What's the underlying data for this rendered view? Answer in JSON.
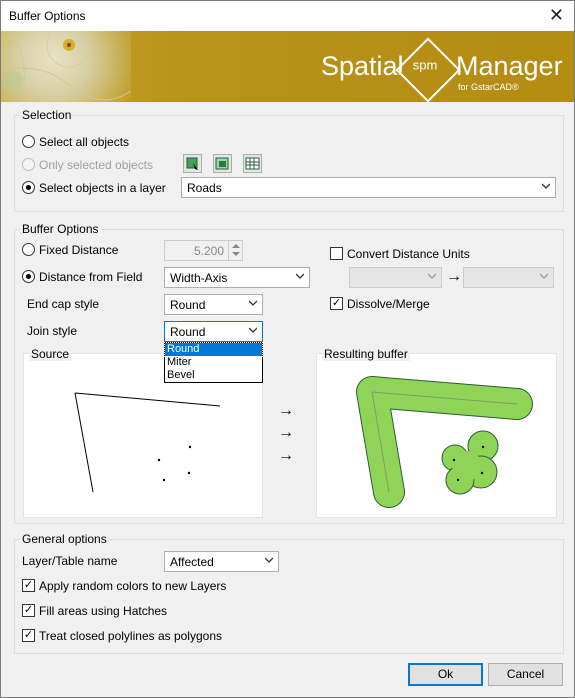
{
  "window": {
    "title": "Buffer Options"
  },
  "banner": {
    "brand_left": "Spatial",
    "brand_logo": "spm",
    "brand_right": "Manager",
    "brand_sub": "for GstarCAD®"
  },
  "selection": {
    "group_label": "Selection",
    "all_objects": "Select all objects",
    "only_selected": "Only selected objects",
    "in_layer": "Select objects in a layer",
    "layer_value": "Roads"
  },
  "buffer": {
    "group_label": "Buffer Options",
    "fixed_distance": "Fixed Distance",
    "fixed_value": "5.200",
    "distance_field": "Distance from Field",
    "field_value": "Width-Axis",
    "end_cap_label": "End cap style",
    "end_cap_value": "Round",
    "join_label": "Join style",
    "join_value": "Round",
    "join_options": [
      "Round",
      "Miter",
      "Bevel"
    ],
    "convert_units": "Convert Distance Units",
    "dissolve": "Dissolve/Merge",
    "source_label": "Source",
    "result_label": "Resulting buffer"
  },
  "general": {
    "group_label": "General options",
    "layer_name_label": "Layer/Table name",
    "layer_name_value": "Affected",
    "random_colors": "Apply random colors to new Layers",
    "fill_hatches": "Fill areas using Hatches",
    "closed_polylines": "Treat closed polylines as polygons"
  },
  "buttons": {
    "ok": "Ok",
    "cancel": "Cancel"
  },
  "colors": {
    "accent": "#0078d7",
    "banner": "#b8921a",
    "buffer_fill": "#8fd357"
  }
}
